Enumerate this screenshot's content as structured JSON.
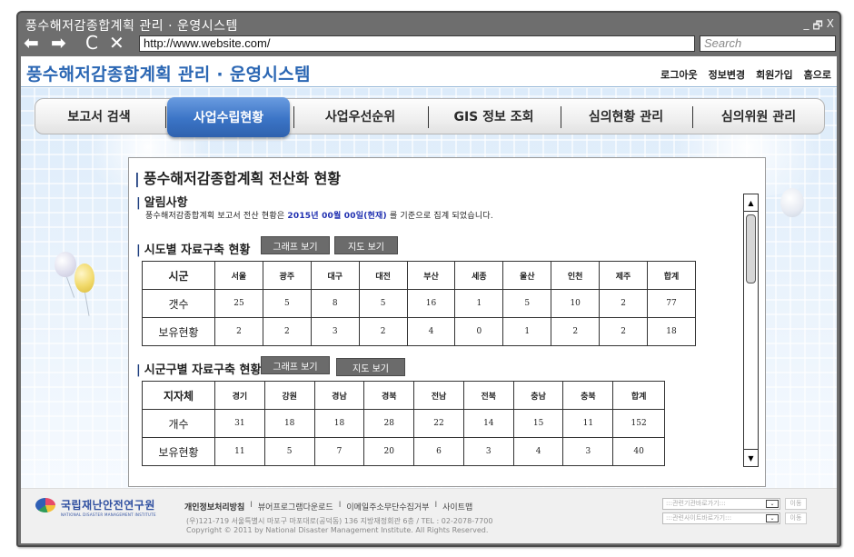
{
  "window": {
    "title": "풍수해저감종합계획 관리 · 운영시스템",
    "controls": {
      "minimize": "_",
      "restore": "🗗",
      "close": "X"
    }
  },
  "browser": {
    "back_icon": "⬅",
    "forward_icon": "➡",
    "reload_icon": "C",
    "stop_icon": "✕",
    "url": "http://www.website.com/",
    "search_placeholder": "Search"
  },
  "site": {
    "title": "풍수해저감종합계획 관리 · 운영시스템",
    "user_links": [
      "로그아웃",
      "정보변경",
      "회원가입",
      "홈으로"
    ]
  },
  "tabs": [
    {
      "label": "보고서 검색",
      "active": false
    },
    {
      "label": "사업수립현황",
      "active": true
    },
    {
      "label": "사업우선순위",
      "active": false
    },
    {
      "label": "GIS 정보 조회",
      "active": false
    },
    {
      "label": "심의현황 관리",
      "active": false
    },
    {
      "label": "심의위원 관리",
      "active": false
    }
  ],
  "content": {
    "page_title": "풍수해저감종합계획 전산화 현황",
    "notice": {
      "heading": "알림사항",
      "text_before": "풍수해저감종합계획 보고서 전산 현황은",
      "highlight": "2015년 00월 00일(현재)",
      "text_after": "를 기준으로 집계 되었습니다."
    },
    "sido_section": {
      "heading": "시도별 자료구축 현황",
      "graph_button": "그래프 보기",
      "map_button": "지도 보기",
      "table": {
        "header": [
          "시군",
          "서울",
          "광주",
          "대구",
          "대전",
          "부산",
          "세종",
          "울산",
          "인천",
          "제주",
          "합계"
        ],
        "rows": [
          [
            "갯수",
            "25",
            "5",
            "8",
            "5",
            "16",
            "1",
            "5",
            "10",
            "2",
            "77"
          ],
          [
            "보유현황",
            "2",
            "2",
            "3",
            "2",
            "4",
            "0",
            "1",
            "2",
            "2",
            "18"
          ]
        ]
      }
    },
    "sigungu_section": {
      "heading": "시군구별 자료구축 현황",
      "graph_button": "그래프 보기",
      "map_button": "지도 보기",
      "table": {
        "header": [
          "지자체",
          "경기",
          "강원",
          "경남",
          "경북",
          "전남",
          "전북",
          "충남",
          "충북",
          "합계"
        ],
        "rows": [
          [
            "개수",
            "31",
            "18",
            "18",
            "28",
            "22",
            "14",
            "15",
            "11",
            "152"
          ],
          [
            "보유현황",
            "11",
            "5",
            "7",
            "20",
            "6",
            "3",
            "4",
            "3",
            "40"
          ]
        ]
      }
    },
    "scrollbar": {
      "up_icon": "▲",
      "down_icon": "▼"
    }
  },
  "footer": {
    "logo_text": "국립재난안전연구원",
    "logo_subtext": "NATIONAL DISASTER MANAGEMENT INSTITUTE",
    "links": [
      "개인정보처리방침",
      "뷰어프로그램다운로드",
      "이메일주소무단수집거부",
      "사이트맵"
    ],
    "link_separator": "I",
    "address": "(우)121-719 서울특별시 마포구 마포대로(공덕동) 136 지방재정회관 6층 / TEL : 02-2078-7700",
    "copyright": "Copyright © 2011 by National Disaster Management Institute. All Rights Reserved.",
    "quick_selects": [
      {
        "selected": ":::관련기관바로가기:::",
        "go_label": "이동"
      },
      {
        "selected": ":::관련사이트바로가기:::",
        "go_label": "이동"
      }
    ],
    "select_arrow_icon": "⌄"
  }
}
